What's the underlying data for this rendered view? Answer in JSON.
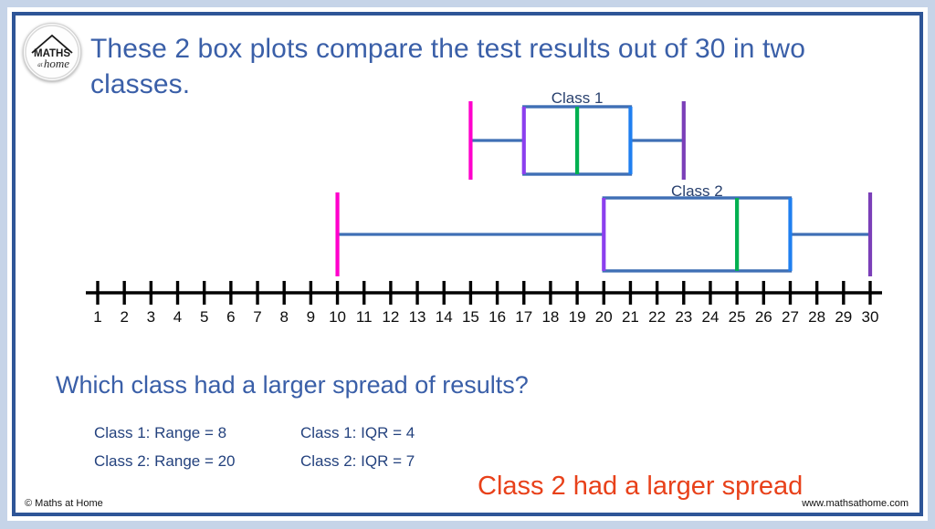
{
  "colors": {
    "heading_blue": "#3a5fa8",
    "frame_blue": "#2e5597",
    "page_border": "#c6d4e8",
    "answer_orange": "#e8411a",
    "whisker_min": "#ff00cc",
    "whisker_max": "#7b3fb8",
    "q1_edge": "#8b3fee",
    "q3_edge": "#1f7ff0",
    "median": "#00b050",
    "box_line": "#3f6fb5",
    "axis_black": "#000000",
    "stats_text": "#24427e"
  },
  "logo": {
    "line1": "MATHS",
    "line2": "at",
    "line3": "home",
    "name": "maths-at-home-logo"
  },
  "heading": {
    "text": "These 2 box plots compare the test results out of 30 in two classes."
  },
  "axis": {
    "min": 1,
    "max": 30,
    "ticks": [
      1,
      2,
      3,
      4,
      5,
      6,
      7,
      8,
      9,
      10,
      11,
      12,
      13,
      14,
      15,
      16,
      17,
      18,
      19,
      20,
      21,
      22,
      23,
      24,
      25,
      26,
      27,
      28,
      29,
      30
    ],
    "tick_labels": [
      "1",
      "2",
      "3",
      "4",
      "5",
      "6",
      "7",
      "8",
      "9",
      "10",
      "11",
      "12",
      "13",
      "14",
      "15",
      "16",
      "17",
      "18",
      "19",
      "20",
      "21",
      "22",
      "23",
      "24",
      "25",
      "26",
      "27",
      "28",
      "29",
      "30"
    ]
  },
  "question": {
    "text": "Which class had a larger spread of results?"
  },
  "stats": {
    "rows": [
      {
        "left": "Class 1: Range = 8",
        "right": "Class 1: IQR = 4"
      },
      {
        "left": "Class 2: Range = 20",
        "right": "Class 2: IQR = 7"
      }
    ]
  },
  "answer": {
    "text": "Class 2 had a larger spread"
  },
  "footer": {
    "copyright": "© Maths at Home",
    "website": "www.mathsathome.com"
  },
  "chart_data": {
    "type": "box",
    "title": "These 2 box plots compare the test results out of 30 in two classes.",
    "xlabel": "",
    "ylabel": "",
    "xlim": [
      1,
      30
    ],
    "grid": false,
    "legend": "none",
    "orientation": "horizontal",
    "series": [
      {
        "name": "Class 1",
        "label": "Class 1",
        "min": 15,
        "q1": 17,
        "median": 19,
        "q3": 21,
        "max": 23,
        "range": 8,
        "iqr": 4
      },
      {
        "name": "Class 2",
        "label": "Class 2",
        "min": 10,
        "q1": 20,
        "median": 25,
        "q3": 27,
        "max": 30,
        "range": 20,
        "iqr": 7
      }
    ],
    "annotations": [
      "Class 1: Range = 8",
      "Class 2: Range = 20",
      "Class 1: IQR = 4",
      "Class 2: IQR = 7",
      "Class 2 had a larger spread"
    ]
  }
}
